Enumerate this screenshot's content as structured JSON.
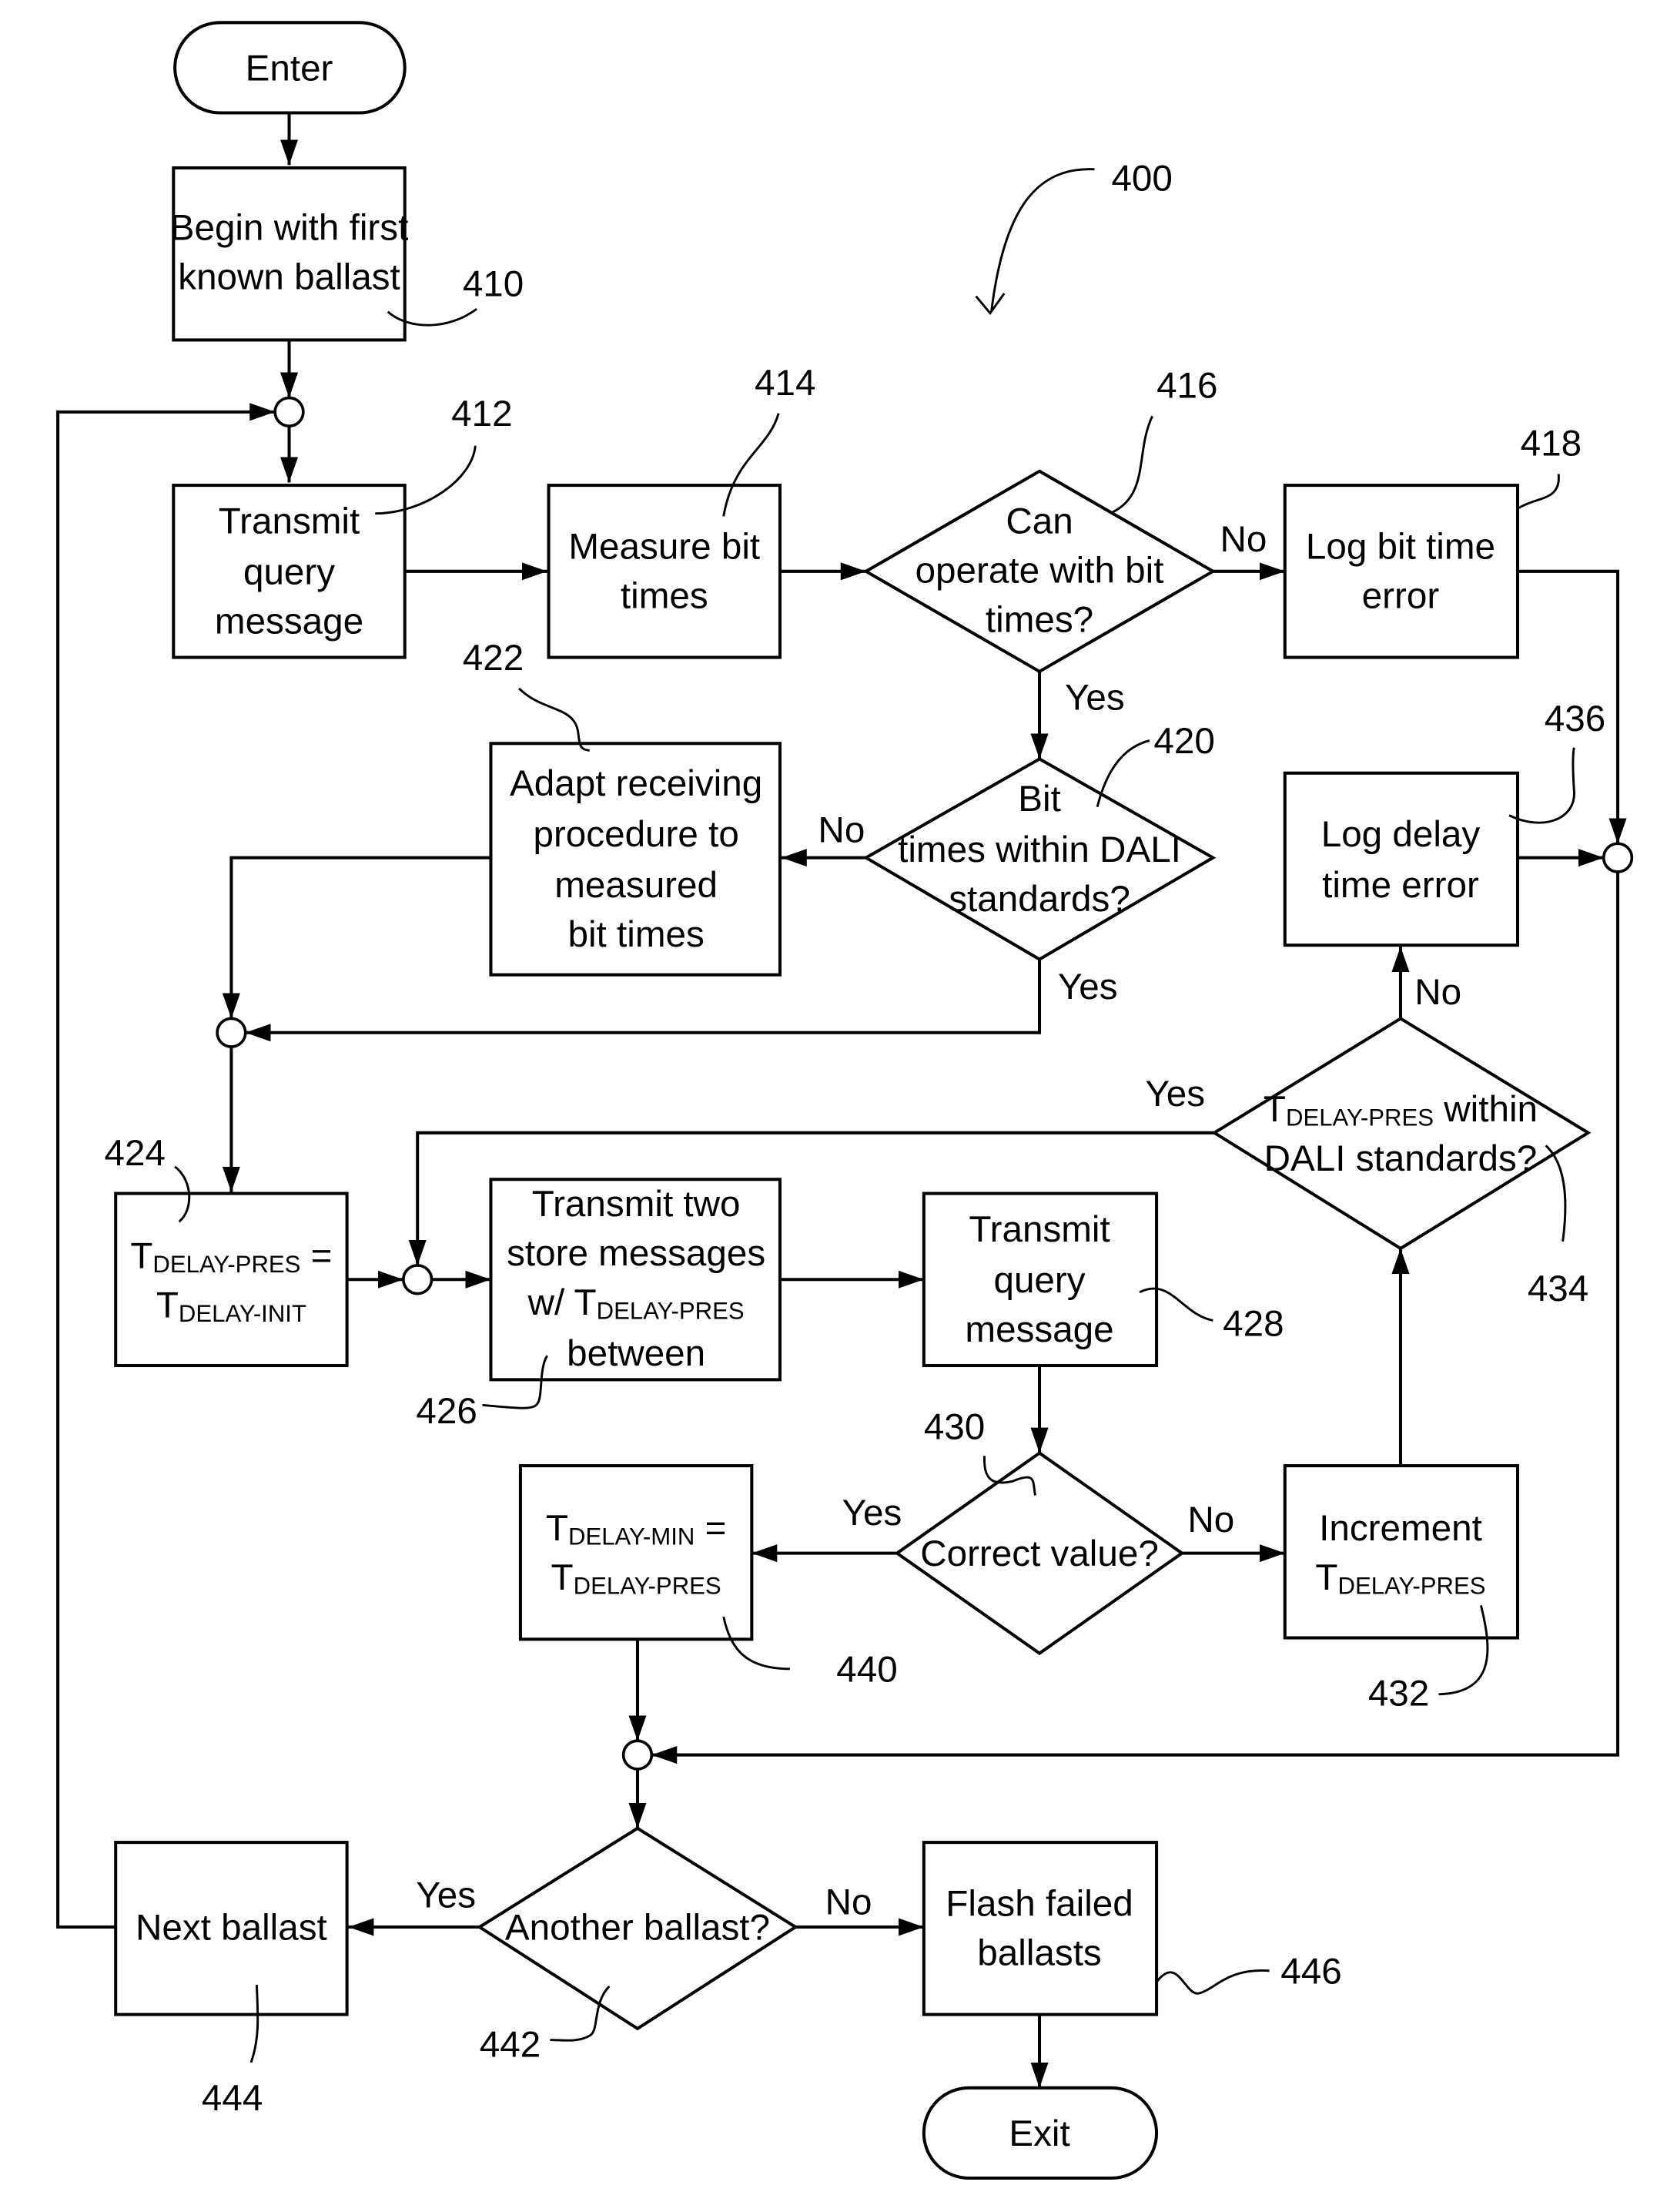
{
  "figure": {
    "reference": "400"
  },
  "nodes": {
    "enter": {
      "label": "Enter"
    },
    "n410": {
      "lines": [
        "Begin with first",
        "known ballast"
      ],
      "ref": "410"
    },
    "n412": {
      "lines": [
        "Transmit",
        "query",
        "message"
      ],
      "ref": "412"
    },
    "n414": {
      "lines": [
        "Measure bit",
        "times"
      ],
      "ref": "414"
    },
    "n416": {
      "lines": [
        "Can",
        "operate with bit",
        "times?"
      ],
      "ref": "416"
    },
    "n418": {
      "lines": [
        "Log bit time",
        "error"
      ],
      "ref": "418"
    },
    "n420": {
      "lines": [
        "Bit",
        "times within DALI",
        "standards?"
      ],
      "ref": "420"
    },
    "n422": {
      "lines": [
        "Adapt receiving",
        "procedure to",
        "measured",
        "bit times"
      ],
      "ref": "422"
    },
    "n424": {
      "line1_main": "T",
      "line1_sub": "DELAY-PRES",
      "line1_tail": " =",
      "line2_main": "T",
      "line2_sub": "DELAY-INIT",
      "ref": "424"
    },
    "n426": {
      "lines": [
        "Transmit two",
        "store messages"
      ],
      "line3_pre": "w/ T",
      "line3_sub": "DELAY-PRES",
      "line4": "between",
      "ref": "426"
    },
    "n428": {
      "lines": [
        "Transmit",
        "query",
        "message"
      ],
      "ref": "428"
    },
    "n430": {
      "label": "Correct value?",
      "ref": "430"
    },
    "n432": {
      "line1": "Increment",
      "line2_main": "T",
      "line2_sub": "DELAY-PRES",
      "ref": "432"
    },
    "n434": {
      "line1_main": "T",
      "line1_sub": "DELAY-PRES",
      "line1_tail": " within",
      "line2": "DALI standards?",
      "ref": "434"
    },
    "n436": {
      "lines": [
        "Log delay",
        "time error"
      ],
      "ref": "436"
    },
    "n440": {
      "line1_main": "T",
      "line1_sub": "DELAY-MIN",
      "line1_tail": " =",
      "line2_main": "T",
      "line2_sub": "DELAY-PRES",
      "ref": "440"
    },
    "n442": {
      "label": "Another ballast?",
      "ref": "442"
    },
    "n444": {
      "label": "Next ballast",
      "ref": "444"
    },
    "n446": {
      "lines": [
        "Flash failed",
        "ballasts"
      ],
      "ref": "446"
    },
    "exit": {
      "label": "Exit"
    }
  },
  "edge_labels": {
    "e416_no": "No",
    "e416_yes": "Yes",
    "e420_no": "No",
    "e420_yes": "Yes",
    "e434_yes": "Yes",
    "e434_no": "No",
    "e430_yes": "Yes",
    "e430_no": "No",
    "e442_yes": "Yes",
    "e442_no": "No"
  }
}
